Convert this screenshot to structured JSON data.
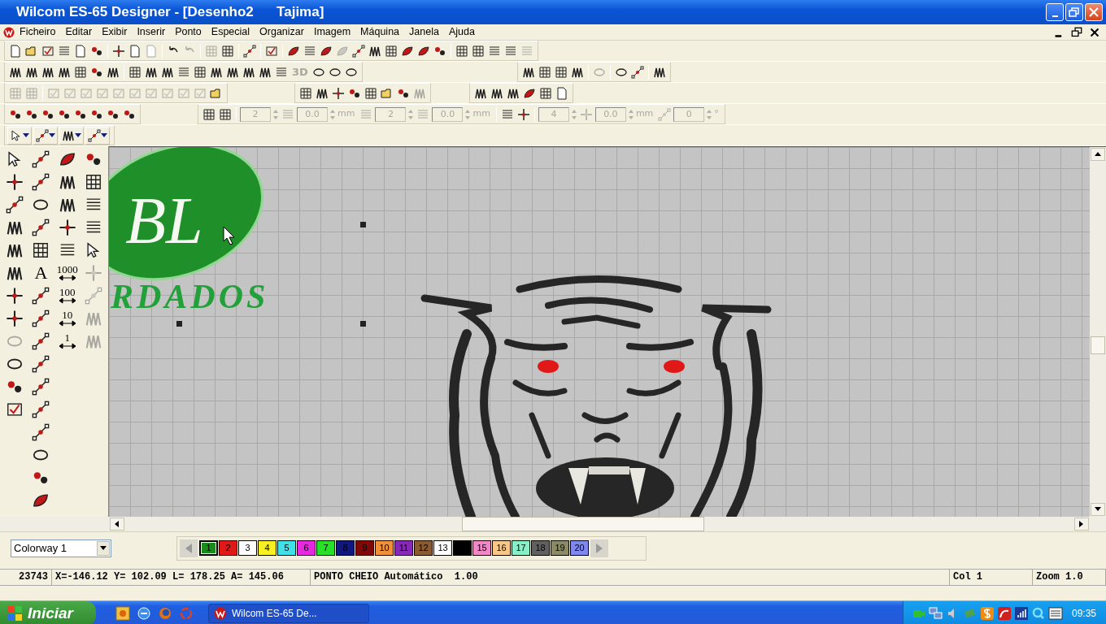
{
  "window": {
    "title": "Wilcom ES-65 Designer - [Desenho2      Tajima]"
  },
  "menu": [
    "Ficheiro",
    "Editar",
    "Exibir",
    "Inserir",
    "Ponto",
    "Especial",
    "Organizar",
    "Imagem",
    "Máquina",
    "Janela",
    "Ajuda"
  ],
  "toolbars": [
    {
      "groups": [
        {
          "items": [
            {
              "kind": "icon",
              "disabled": false
            },
            {
              "kind": "icon",
              "disabled": false
            },
            {
              "kind": "icon",
              "disabled": false
            },
            {
              "kind": "icon",
              "disabled": false
            },
            {
              "kind": "icon",
              "disabled": false
            },
            {
              "kind": "icon",
              "disabled": false
            },
            {
              "kind": "sep"
            },
            {
              "kind": "icon",
              "disabled": false
            },
            {
              "kind": "icon",
              "disabled": false
            },
            {
              "kind": "icon",
              "disabled": true
            },
            {
              "kind": "sep"
            },
            {
              "kind": "icon",
              "disabled": false
            },
            {
              "kind": "icon",
              "disabled": true
            },
            {
              "kind": "sep"
            },
            {
              "kind": "icon",
              "disabled": true
            },
            {
              "kind": "icon",
              "disabled": false
            },
            {
              "kind": "sep"
            },
            {
              "kind": "icon",
              "disabled": false
            },
            {
              "kind": "sep"
            },
            {
              "kind": "icon",
              "disabled": false
            },
            {
              "kind": "sep"
            },
            {
              "kind": "icon",
              "disabled": false
            },
            {
              "kind": "icon",
              "disabled": false
            },
            {
              "kind": "icon",
              "disabled": false
            },
            {
              "kind": "icon",
              "disabled": true
            },
            {
              "kind": "icon",
              "disabled": false
            },
            {
              "kind": "icon",
              "disabled": false
            },
            {
              "kind": "icon",
              "disabled": false
            },
            {
              "kind": "icon",
              "disabled": false
            },
            {
              "kind": "icon",
              "disabled": false
            },
            {
              "kind": "icon",
              "disabled": false
            },
            {
              "kind": "sep"
            },
            {
              "kind": "icon",
              "disabled": false
            },
            {
              "kind": "icon",
              "disabled": false
            },
            {
              "kind": "icon",
              "disabled": false
            },
            {
              "kind": "icon",
              "disabled": false
            },
            {
              "kind": "icon",
              "disabled": true
            }
          ]
        }
      ]
    },
    {
      "groups": [
        {
          "items": [
            {
              "kind": "icon",
              "disabled": false
            },
            {
              "kind": "icon",
              "disabled": false
            },
            {
              "kind": "icon",
              "disabled": false
            },
            {
              "kind": "icon",
              "disabled": false
            },
            {
              "kind": "icon",
              "disabled": false
            },
            {
              "kind": "icon",
              "disabled": false
            },
            {
              "kind": "icon",
              "disabled": false
            },
            {
              "kind": "sep"
            },
            {
              "kind": "icon",
              "disabled": false
            },
            {
              "kind": "icon",
              "disabled": false
            },
            {
              "kind": "icon",
              "disabled": false
            },
            {
              "kind": "icon",
              "disabled": false
            },
            {
              "kind": "icon",
              "disabled": false
            },
            {
              "kind": "icon",
              "disabled": false
            },
            {
              "kind": "icon",
              "disabled": false
            },
            {
              "kind": "icon",
              "disabled": false
            },
            {
              "kind": "icon",
              "disabled": false
            },
            {
              "kind": "icon",
              "disabled": false
            },
            {
              "kind": "label",
              "text": "3D",
              "disabled": true
            },
            {
              "kind": "icon",
              "disabled": false
            },
            {
              "kind": "icon",
              "disabled": false
            },
            {
              "kind": "icon",
              "disabled": false
            }
          ]
        },
        {
          "items": [
            {
              "kind": "icon",
              "disabled": false
            },
            {
              "kind": "icon",
              "disabled": false
            },
            {
              "kind": "icon",
              "disabled": false
            },
            {
              "kind": "icon",
              "disabled": false
            },
            {
              "kind": "sep"
            },
            {
              "kind": "icon",
              "disabled": true
            },
            {
              "kind": "sep"
            },
            {
              "kind": "icon",
              "disabled": false
            },
            {
              "kind": "icon",
              "disabled": false
            },
            {
              "kind": "sep"
            },
            {
              "kind": "icon",
              "disabled": false
            }
          ]
        }
      ]
    },
    {
      "groups": [
        {
          "items": [
            {
              "kind": "icon",
              "disabled": true
            },
            {
              "kind": "icon",
              "disabled": true
            },
            {
              "kind": "sep"
            },
            {
              "kind": "icon",
              "disabled": true
            },
            {
              "kind": "icon",
              "disabled": true
            },
            {
              "kind": "icon",
              "disabled": true
            },
            {
              "kind": "icon",
              "disabled": true
            },
            {
              "kind": "icon",
              "disabled": true
            },
            {
              "kind": "icon",
              "disabled": true
            },
            {
              "kind": "icon",
              "disabled": true
            },
            {
              "kind": "icon",
              "disabled": true
            },
            {
              "kind": "icon",
              "disabled": true
            },
            {
              "kind": "icon",
              "disabled": true
            },
            {
              "kind": "icon",
              "disabled": false
            }
          ]
        },
        {
          "items": [
            {
              "kind": "icon",
              "disabled": false
            },
            {
              "kind": "icon",
              "disabled": false
            },
            {
              "kind": "icon",
              "disabled": false
            },
            {
              "kind": "icon",
              "disabled": false
            },
            {
              "kind": "icon",
              "disabled": false
            },
            {
              "kind": "icon",
              "disabled": false
            },
            {
              "kind": "icon",
              "disabled": false
            },
            {
              "kind": "icon",
              "disabled": true
            }
          ]
        },
        {
          "items": [
            {
              "kind": "icon",
              "disabled": false
            },
            {
              "kind": "icon",
              "disabled": false
            },
            {
              "kind": "icon",
              "disabled": false
            },
            {
              "kind": "icon",
              "disabled": false
            },
            {
              "kind": "icon",
              "disabled": false
            },
            {
              "kind": "icon",
              "disabled": false
            }
          ]
        }
      ]
    },
    {
      "groups": [
        {
          "items": [
            {
              "kind": "icon",
              "disabled": false
            },
            {
              "kind": "icon",
              "disabled": false
            },
            {
              "kind": "icon",
              "disabled": false
            },
            {
              "kind": "icon",
              "disabled": false
            },
            {
              "kind": "icon",
              "disabled": false
            },
            {
              "kind": "icon",
              "disabled": false
            },
            {
              "kind": "icon",
              "disabled": false
            },
            {
              "kind": "icon",
              "disabled": false
            }
          ]
        },
        {
          "items": [
            {
              "kind": "icon",
              "disabled": false
            },
            {
              "kind": "icon",
              "disabled": false
            },
            {
              "kind": "sep"
            },
            {
              "kind": "spin",
              "value": "2",
              "disabled": true
            },
            {
              "kind": "icon",
              "disabled": true
            },
            {
              "kind": "spin",
              "value": "0.0",
              "disabled": true
            },
            {
              "kind": "unit",
              "text": "mm",
              "disabled": true
            },
            {
              "kind": "icon",
              "disabled": true
            },
            {
              "kind": "spin",
              "value": "2",
              "disabled": true
            },
            {
              "kind": "icon",
              "disabled": true
            },
            {
              "kind": "spin",
              "value": "0.0",
              "disabled": true
            },
            {
              "kind": "unit",
              "text": "mm",
              "disabled": true
            },
            {
              "kind": "sep"
            },
            {
              "kind": "icon",
              "disabled": false
            },
            {
              "kind": "icon",
              "disabled": false
            },
            {
              "kind": "sep"
            },
            {
              "kind": "spin",
              "value": "4",
              "disabled": true
            },
            {
              "kind": "icon",
              "disabled": true
            },
            {
              "kind": "spin",
              "value": "0.0",
              "disabled": true
            },
            {
              "kind": "unit",
              "text": "mm",
              "disabled": true
            },
            {
              "kind": "icon",
              "disabled": true
            },
            {
              "kind": "spin",
              "value": "0",
              "disabled": true
            },
            {
              "kind": "unit",
              "text": "°",
              "disabled": true
            }
          ]
        }
      ]
    },
    {
      "groups": [
        {
          "items": [
            {
              "kind": "dropdown",
              "disabled": false
            },
            {
              "kind": "dropdown",
              "disabled": false
            },
            {
              "kind": "dropdown",
              "disabled": false
            },
            {
              "kind": "dropdown",
              "disabled": false
            }
          ]
        }
      ]
    }
  ],
  "toolbox": {
    "columns": [
      [
        {
          "kind": "icon",
          "disabled": false
        },
        {
          "kind": "icon",
          "disabled": false
        },
        {
          "kind": "icon",
          "disabled": false
        },
        {
          "kind": "icon",
          "disabled": false
        },
        {
          "kind": "icon",
          "disabled": false
        },
        {
          "kind": "icon",
          "disabled": false
        },
        {
          "kind": "icon",
          "disabled": false
        },
        {
          "kind": "icon",
          "disabled": false
        },
        {
          "kind": "icon",
          "disabled": true
        },
        {
          "kind": "icon",
          "disabled": false
        },
        {
          "kind": "icon",
          "disabled": false
        },
        {
          "kind": "icon",
          "disabled": false
        }
      ],
      [
        {
          "kind": "icon",
          "disabled": false
        },
        {
          "kind": "icon",
          "disabled": false
        },
        {
          "kind": "icon",
          "disabled": false
        },
        {
          "kind": "icon",
          "disabled": false
        },
        {
          "kind": "icon",
          "disabled": false
        },
        {
          "kind": "label",
          "text": "A",
          "disabled": false
        },
        {
          "kind": "icon",
          "disabled": false
        },
        {
          "kind": "icon",
          "disabled": false
        },
        {
          "kind": "icon",
          "disabled": false
        },
        {
          "kind": "icon",
          "disabled": false
        },
        {
          "kind": "icon",
          "disabled": false
        },
        {
          "kind": "icon",
          "disabled": false
        },
        {
          "kind": "icon",
          "disabled": false
        },
        {
          "kind": "icon",
          "disabled": false
        },
        {
          "kind": "icon",
          "disabled": false
        },
        {
          "kind": "icon",
          "disabled": false
        }
      ],
      [
        {
          "kind": "icon",
          "disabled": false
        },
        {
          "kind": "icon",
          "disabled": false
        },
        {
          "kind": "icon",
          "disabled": false
        },
        {
          "kind": "icon",
          "disabled": false
        },
        {
          "kind": "icon",
          "disabled": false
        },
        {
          "kind": "label",
          "text": "1000",
          "disabled": false
        },
        {
          "kind": "label",
          "text": "100",
          "disabled": false
        },
        {
          "kind": "label",
          "text": "10",
          "disabled": false
        },
        {
          "kind": "label",
          "text": "1",
          "disabled": false
        }
      ],
      [
        {
          "kind": "icon",
          "disabled": false
        },
        {
          "kind": "icon",
          "disabled": false
        },
        {
          "kind": "icon",
          "disabled": false
        },
        {
          "kind": "icon",
          "disabled": false
        },
        {
          "kind": "icon",
          "disabled": false
        },
        {
          "kind": "icon",
          "disabled": true
        },
        {
          "kind": "icon",
          "disabled": true
        },
        {
          "kind": "icon",
          "disabled": true
        },
        {
          "kind": "icon",
          "disabled": true
        }
      ]
    ]
  },
  "canvas": {
    "design_texts": [
      "BL",
      "RDADOS"
    ]
  },
  "colorway": {
    "value": "Colorway 1"
  },
  "palette": {
    "colors": [
      {
        "label": "1",
        "color": "#1a8a1a",
        "selected": true
      },
      {
        "label": "2",
        "color": "#e01818",
        "selected": false
      },
      {
        "label": "3",
        "color": "#ffffff",
        "selected": false
      },
      {
        "label": "4",
        "color": "#f8f020",
        "selected": false
      },
      {
        "label": "5",
        "color": "#40e0e8",
        "selected": false
      },
      {
        "label": "6",
        "color": "#e828e0",
        "selected": false
      },
      {
        "label": "7",
        "color": "#28e028",
        "selected": false
      },
      {
        "label": "8",
        "color": "#101880",
        "selected": false
      },
      {
        "label": "9",
        "color": "#800808",
        "selected": false
      },
      {
        "label": "10",
        "color": "#f09038",
        "selected": false
      },
      {
        "label": "11",
        "color": "#8828b8",
        "selected": false
      },
      {
        "label": "12",
        "color": "#8a5a30",
        "selected": false
      },
      {
        "label": "13",
        "color": "#ffffff",
        "selected": false
      },
      {
        "color": "#000000",
        "selected": false
      },
      {
        "label": "15",
        "color": "#f088c8",
        "selected": false
      },
      {
        "label": "16",
        "color": "#f8c888",
        "selected": false
      },
      {
        "label": "17",
        "color": "#88f0c8",
        "selected": false
      },
      {
        "label": "18",
        "color": "#606060",
        "selected": false
      },
      {
        "label": "19",
        "color": "#8a8a68",
        "selected": false
      },
      {
        "label": "20",
        "color": "#8088f0",
        "selected": false
      }
    ]
  },
  "status_bar": {
    "count": "23743",
    "coords": "X=-146.12 Y= 102.09 L= 178.25 A= 145.06",
    "stitch": "PONTO CHEIO Automático  1.00",
    "color_info": "Col 1",
    "zoom": "Zoom 1.0"
  },
  "taskbar": {
    "start": "Iniciar",
    "tasks": [
      "Wilcom ES-65 De..."
    ],
    "clock": "09:35"
  }
}
